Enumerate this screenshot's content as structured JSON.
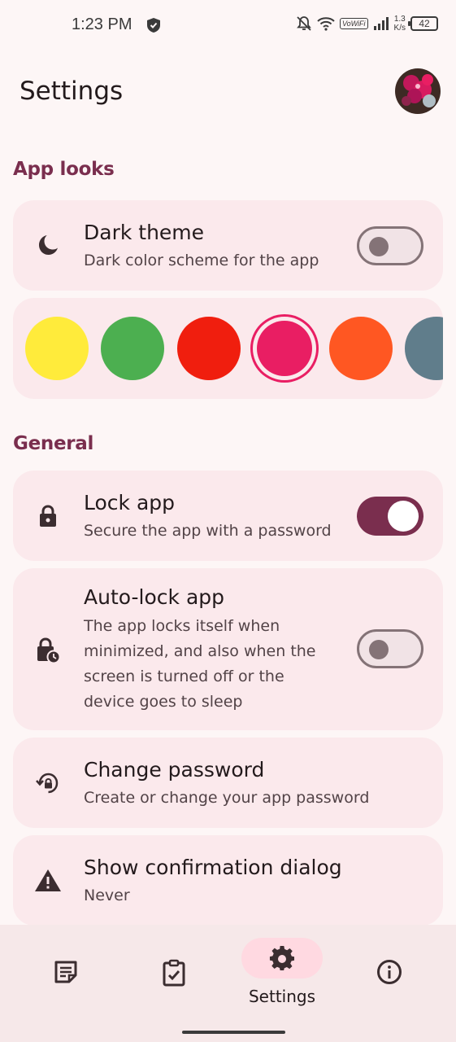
{
  "status_bar": {
    "time": "1:23 PM",
    "volte": "VoWiFi",
    "speed_value": "1.3",
    "speed_unit": "K/s",
    "battery": "42"
  },
  "header": {
    "title": "Settings"
  },
  "sections": {
    "app_looks": "App looks",
    "general": "General"
  },
  "dark_theme": {
    "title": "Dark theme",
    "subtitle": "Dark color scheme for the app",
    "enabled": false
  },
  "colors": [
    {
      "hex": "#ffeb3b",
      "selected": false
    },
    {
      "hex": "#4caf50",
      "selected": false
    },
    {
      "hex": "#f01e0e",
      "selected": false
    },
    {
      "hex": "#e91e63",
      "selected": true
    },
    {
      "hex": "#ff5722",
      "selected": false
    },
    {
      "hex": "#607d8b",
      "selected": false
    }
  ],
  "lock_app": {
    "title": "Lock app",
    "subtitle": "Secure the app with a password",
    "enabled": true
  },
  "auto_lock": {
    "title": "Auto-lock app",
    "subtitle": "The app locks itself when minimized, and also when the screen is turned off or the device goes to sleep",
    "enabled": false
  },
  "change_password": {
    "title": "Change password",
    "subtitle": "Create or change your app password"
  },
  "confirmation": {
    "title": "Show confirmation dialog",
    "subtitle": "Never"
  },
  "bottom_nav": {
    "items": [
      {
        "icon": "notes-icon"
      },
      {
        "icon": "checklist-icon"
      },
      {
        "icon": "gear-icon",
        "label": "Settings",
        "active": true
      },
      {
        "icon": "info-icon"
      }
    ]
  },
  "accent_color": "#7a2e4e"
}
